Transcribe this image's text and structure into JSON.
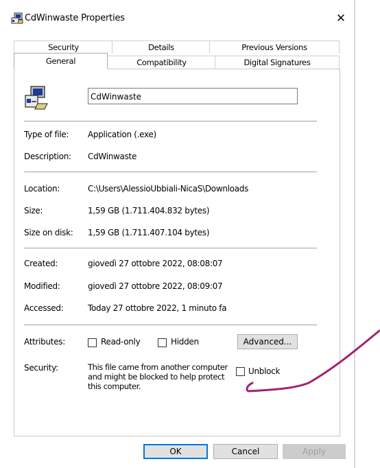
{
  "window": {
    "title": "CdWinwaste Properties",
    "close_glyph": "✕"
  },
  "tabs": {
    "row1": [
      "Security",
      "Details",
      "Previous Versions"
    ],
    "row2": [
      "General",
      "Compatibility",
      "Digital Signatures"
    ],
    "active": "General"
  },
  "general": {
    "file_name": "CdWinwaste",
    "fields": [
      {
        "label": "Type of file:",
        "value": "Application (.exe)"
      },
      {
        "label": "Description:",
        "value": "CdWinwaste"
      },
      {
        "label": "Location:",
        "value": "C:\\Users\\AlessioUbbiali-NicaS\\Downloads"
      },
      {
        "label": "Size:",
        "value": "1,59 GB (1.711.404.832 bytes)"
      },
      {
        "label": "Size on disk:",
        "value": "1,59 GB (1.711.407.104 bytes)"
      },
      {
        "label": "Created:",
        "value": "giovedì 27 ottobre 2022, 08:08:07"
      },
      {
        "label": "Modified:",
        "value": "giovedì 27 ottobre 2022, 08:09:07"
      },
      {
        "label": "Accessed:",
        "value": "Today 27 ottobre 2022, 1 minuto fa"
      }
    ],
    "attributes": {
      "label": "Attributes:",
      "read_only": "Read-only",
      "hidden": "Hidden",
      "advanced_button": "Advanced..."
    },
    "security": {
      "label": "Security:",
      "message": "This file came from another computer and might be blocked to help protect this computer.",
      "unblock_label": "Unblock"
    }
  },
  "buttons": {
    "ok": "OK",
    "cancel": "Cancel",
    "apply": "Apply"
  },
  "colors": {
    "accent": "#0078d7",
    "annotation": "#a5206e"
  },
  "icons": [
    "app-icon",
    "close-icon",
    "program-icon"
  ]
}
